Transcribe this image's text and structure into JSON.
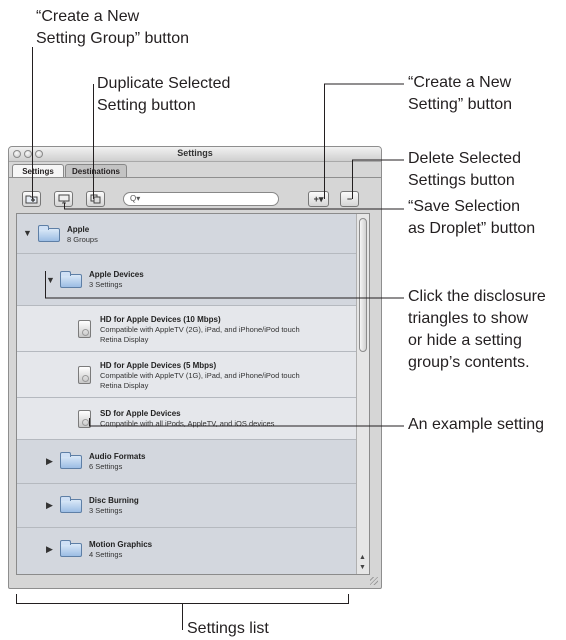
{
  "callouts": {
    "create_group": "“Create a New\nSetting Group” button",
    "duplicate": "Duplicate Selected\nSetting button",
    "create_setting": "“Create a New\nSetting” button",
    "delete": "Delete Selected\nSettings button",
    "droplet": "“Save Selection\nas Droplet” button",
    "disclosure": "Click the disclosure\ntriangles to show\nor hide a setting\ngroup’s contents.",
    "example": "An example setting",
    "settings_list": "Settings list"
  },
  "window": {
    "title": "Settings",
    "tabs": [
      "Settings",
      "Destinations"
    ],
    "toolbar": {
      "create_group_icon": "folder-plus-icon",
      "droplet_icon": "droplet-icon",
      "duplicate_icon": "duplicate-icon",
      "search_placeholder": "Q▾",
      "add_label": "+▾",
      "remove_label": "−"
    }
  },
  "list": {
    "apple": {
      "title": "Apple",
      "subtitle": "8 Groups",
      "expanded": true
    },
    "apple_devices": {
      "title": "Apple Devices",
      "subtitle": "3 Settings",
      "expanded": true
    },
    "items": [
      {
        "title": "HD for Apple Devices (10 Mbps)",
        "line1": "Compatible with AppleTV (2G), iPad, and iPhone/iPod touch",
        "line2": "Retina Display"
      },
      {
        "title": "HD for Apple Devices (5 Mbps)",
        "line1": "Compatible with AppleTV (1G), iPad, and iPhone/iPod touch",
        "line2": "Retina Display"
      },
      {
        "title": "SD for Apple Devices",
        "line1": "Compatible with all iPods, AppleTV, and iOS devices"
      }
    ],
    "groups": [
      {
        "title": "Audio Formats",
        "subtitle": "6 Settings"
      },
      {
        "title": "Disc Burning",
        "subtitle": "3 Settings"
      },
      {
        "title": "Motion Graphics",
        "subtitle": "4 Settings"
      }
    ]
  }
}
